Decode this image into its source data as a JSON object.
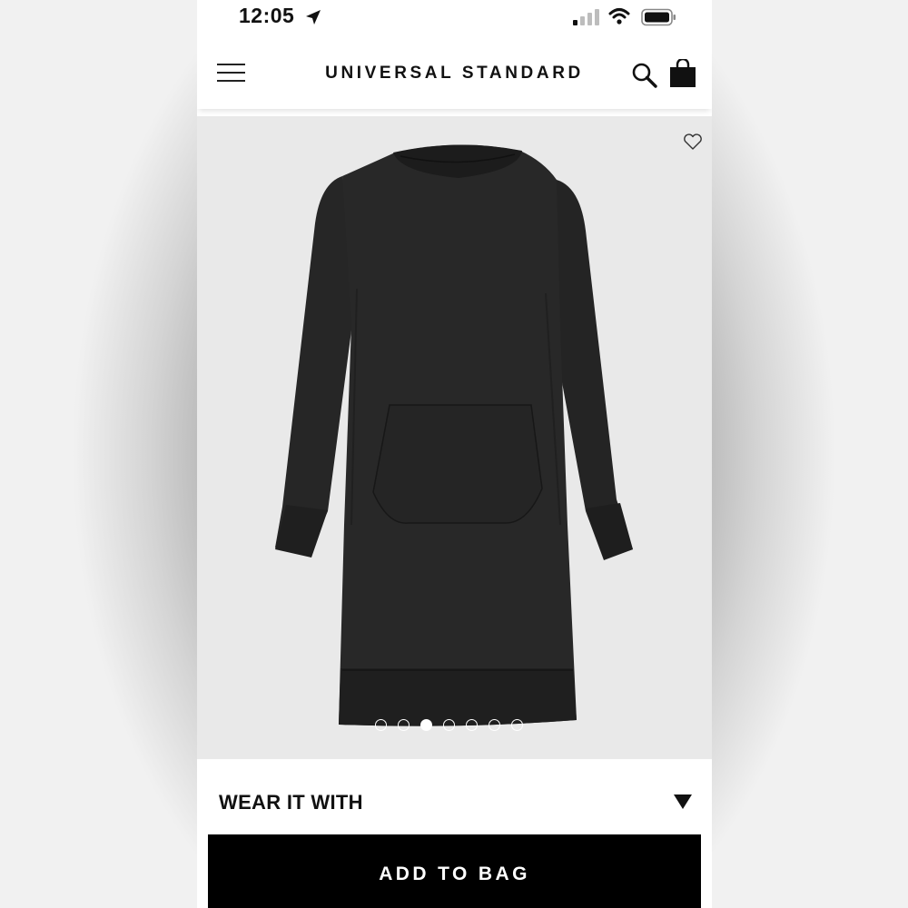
{
  "status_bar": {
    "time": "12:05",
    "icons": [
      "location-arrow-icon",
      "cellular-signal-icon",
      "wifi-icon",
      "battery-icon"
    ]
  },
  "header": {
    "brand": "UNIVERSAL STANDARD",
    "icons": [
      "menu-icon",
      "search-icon",
      "shopping-bag-icon"
    ]
  },
  "product": {
    "image": "black-sweatshirt-dress-image",
    "favorite_icon": "heart-icon",
    "carousel": {
      "total": 7,
      "active_index": 2
    }
  },
  "wear_it_with": {
    "label": "WEAR IT WITH",
    "icon": "triangle-down-icon"
  },
  "add_to_bag": {
    "label": "ADD TO BAG"
  },
  "colors": {
    "background_outer": "#8e8e8e",
    "page": "#ffffff",
    "image_bg": "#e9e9e9",
    "dress": "#222222",
    "button": "#000000",
    "button_text": "#ffffff"
  }
}
